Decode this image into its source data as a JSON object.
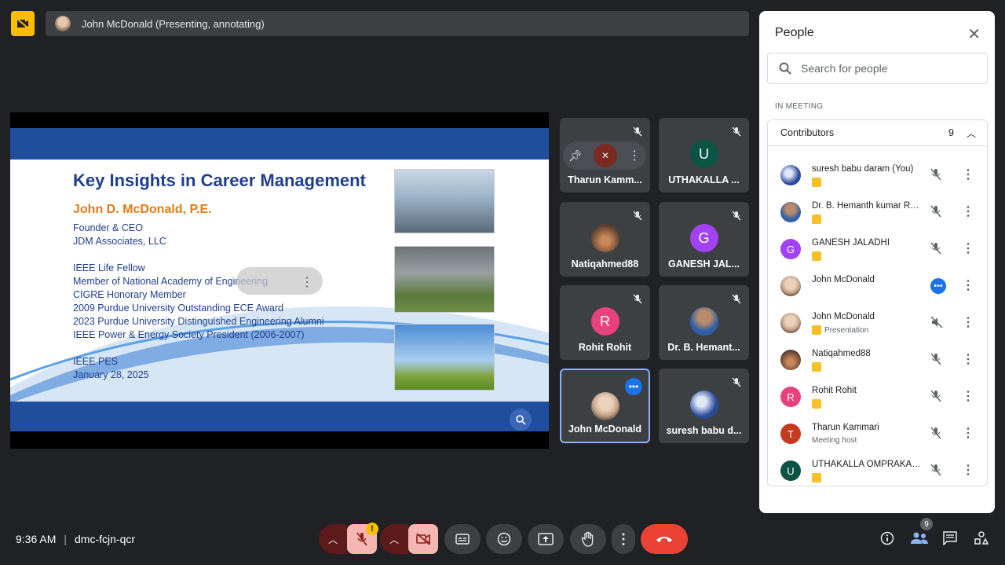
{
  "presenter_bar": {
    "label": "John McDonald (Presenting, annotating)"
  },
  "slide": {
    "title": "Key Insights in Career Management",
    "author": "John D. McDonald, P.E.",
    "lines": [
      "Founder & CEO",
      "JDM Associates, LLC",
      "",
      "IEEE Life Fellow",
      "Member of National Academy of Engineering",
      "CIGRE Honorary Member",
      "2009 Purdue University Outstanding ECE Award",
      "2023 Purdue University Distinguished Engineering Alumni",
      "IEEE Power & Energy Society President (2006-2007)",
      "",
      "IEEE PES",
      "January 28, 2025"
    ]
  },
  "tiles": [
    {
      "name": "Tharun Kamm...",
      "avatar": "",
      "color": "#3c4043",
      "hover": true
    },
    {
      "name": "UTHAKALLA ...",
      "avatar": "U",
      "color": "#0b5345"
    },
    {
      "name": "Natiqahmed88",
      "avatar": "",
      "color": "#7a5a46"
    },
    {
      "name": "GANESH JAL...",
      "avatar": "G",
      "color": "#a142f4"
    },
    {
      "name": "Rohit Rohit",
      "avatar": "R",
      "color": "#e8427c"
    },
    {
      "name": "Dr. B. Hemant...",
      "avatar": "",
      "color": "#2f5fa8"
    },
    {
      "name": "John McDonald",
      "avatar": "",
      "color": "#c7a68a",
      "active": true
    },
    {
      "name": "suresh babu d...",
      "avatar": "",
      "color": "#2a4a9a"
    }
  ],
  "people_panel": {
    "title": "People",
    "search_placeholder": "Search for people",
    "section_label": "IN MEETING",
    "group_label": "Contributors",
    "group_count": "9",
    "participants": [
      {
        "name": "suresh babu daram (You)",
        "sub": "",
        "avatar": "",
        "color": "#2a4a9a",
        "status": "muted"
      },
      {
        "name": "Dr. B. Hemanth kumar Re...",
        "sub": "",
        "avatar": "",
        "color": "#2f5fa8",
        "status": "muted"
      },
      {
        "name": "GANESH JALADHI",
        "sub": "",
        "avatar": "G",
        "color": "#a142f4",
        "status": "muted"
      },
      {
        "name": "John McDonald",
        "sub": "",
        "avatar": "",
        "color": "#c7a68a",
        "status": "speaking"
      },
      {
        "name": "John McDonald",
        "sub": "Presentation",
        "avatar": "",
        "color": "#c7a68a",
        "status": "presenting"
      },
      {
        "name": "Natiqahmed88",
        "sub": "",
        "avatar": "",
        "color": "#7a5a46",
        "status": "muted"
      },
      {
        "name": "Rohit Rohit",
        "sub": "",
        "avatar": "R",
        "color": "#e8427c",
        "status": "muted"
      },
      {
        "name": "Tharun Kammari",
        "sub": "Meeting host",
        "avatar": "T",
        "color": "#c5391f",
        "status": "muted"
      },
      {
        "name": "UTHAKALLA OMPRAKASH",
        "sub": "",
        "avatar": "U",
        "color": "#0b5345",
        "status": "muted"
      }
    ]
  },
  "bottom_bar": {
    "time": "9:36 AM",
    "meeting_code": "dmc-fcjn-qcr",
    "warning_badge": "!",
    "people_count": "9"
  }
}
